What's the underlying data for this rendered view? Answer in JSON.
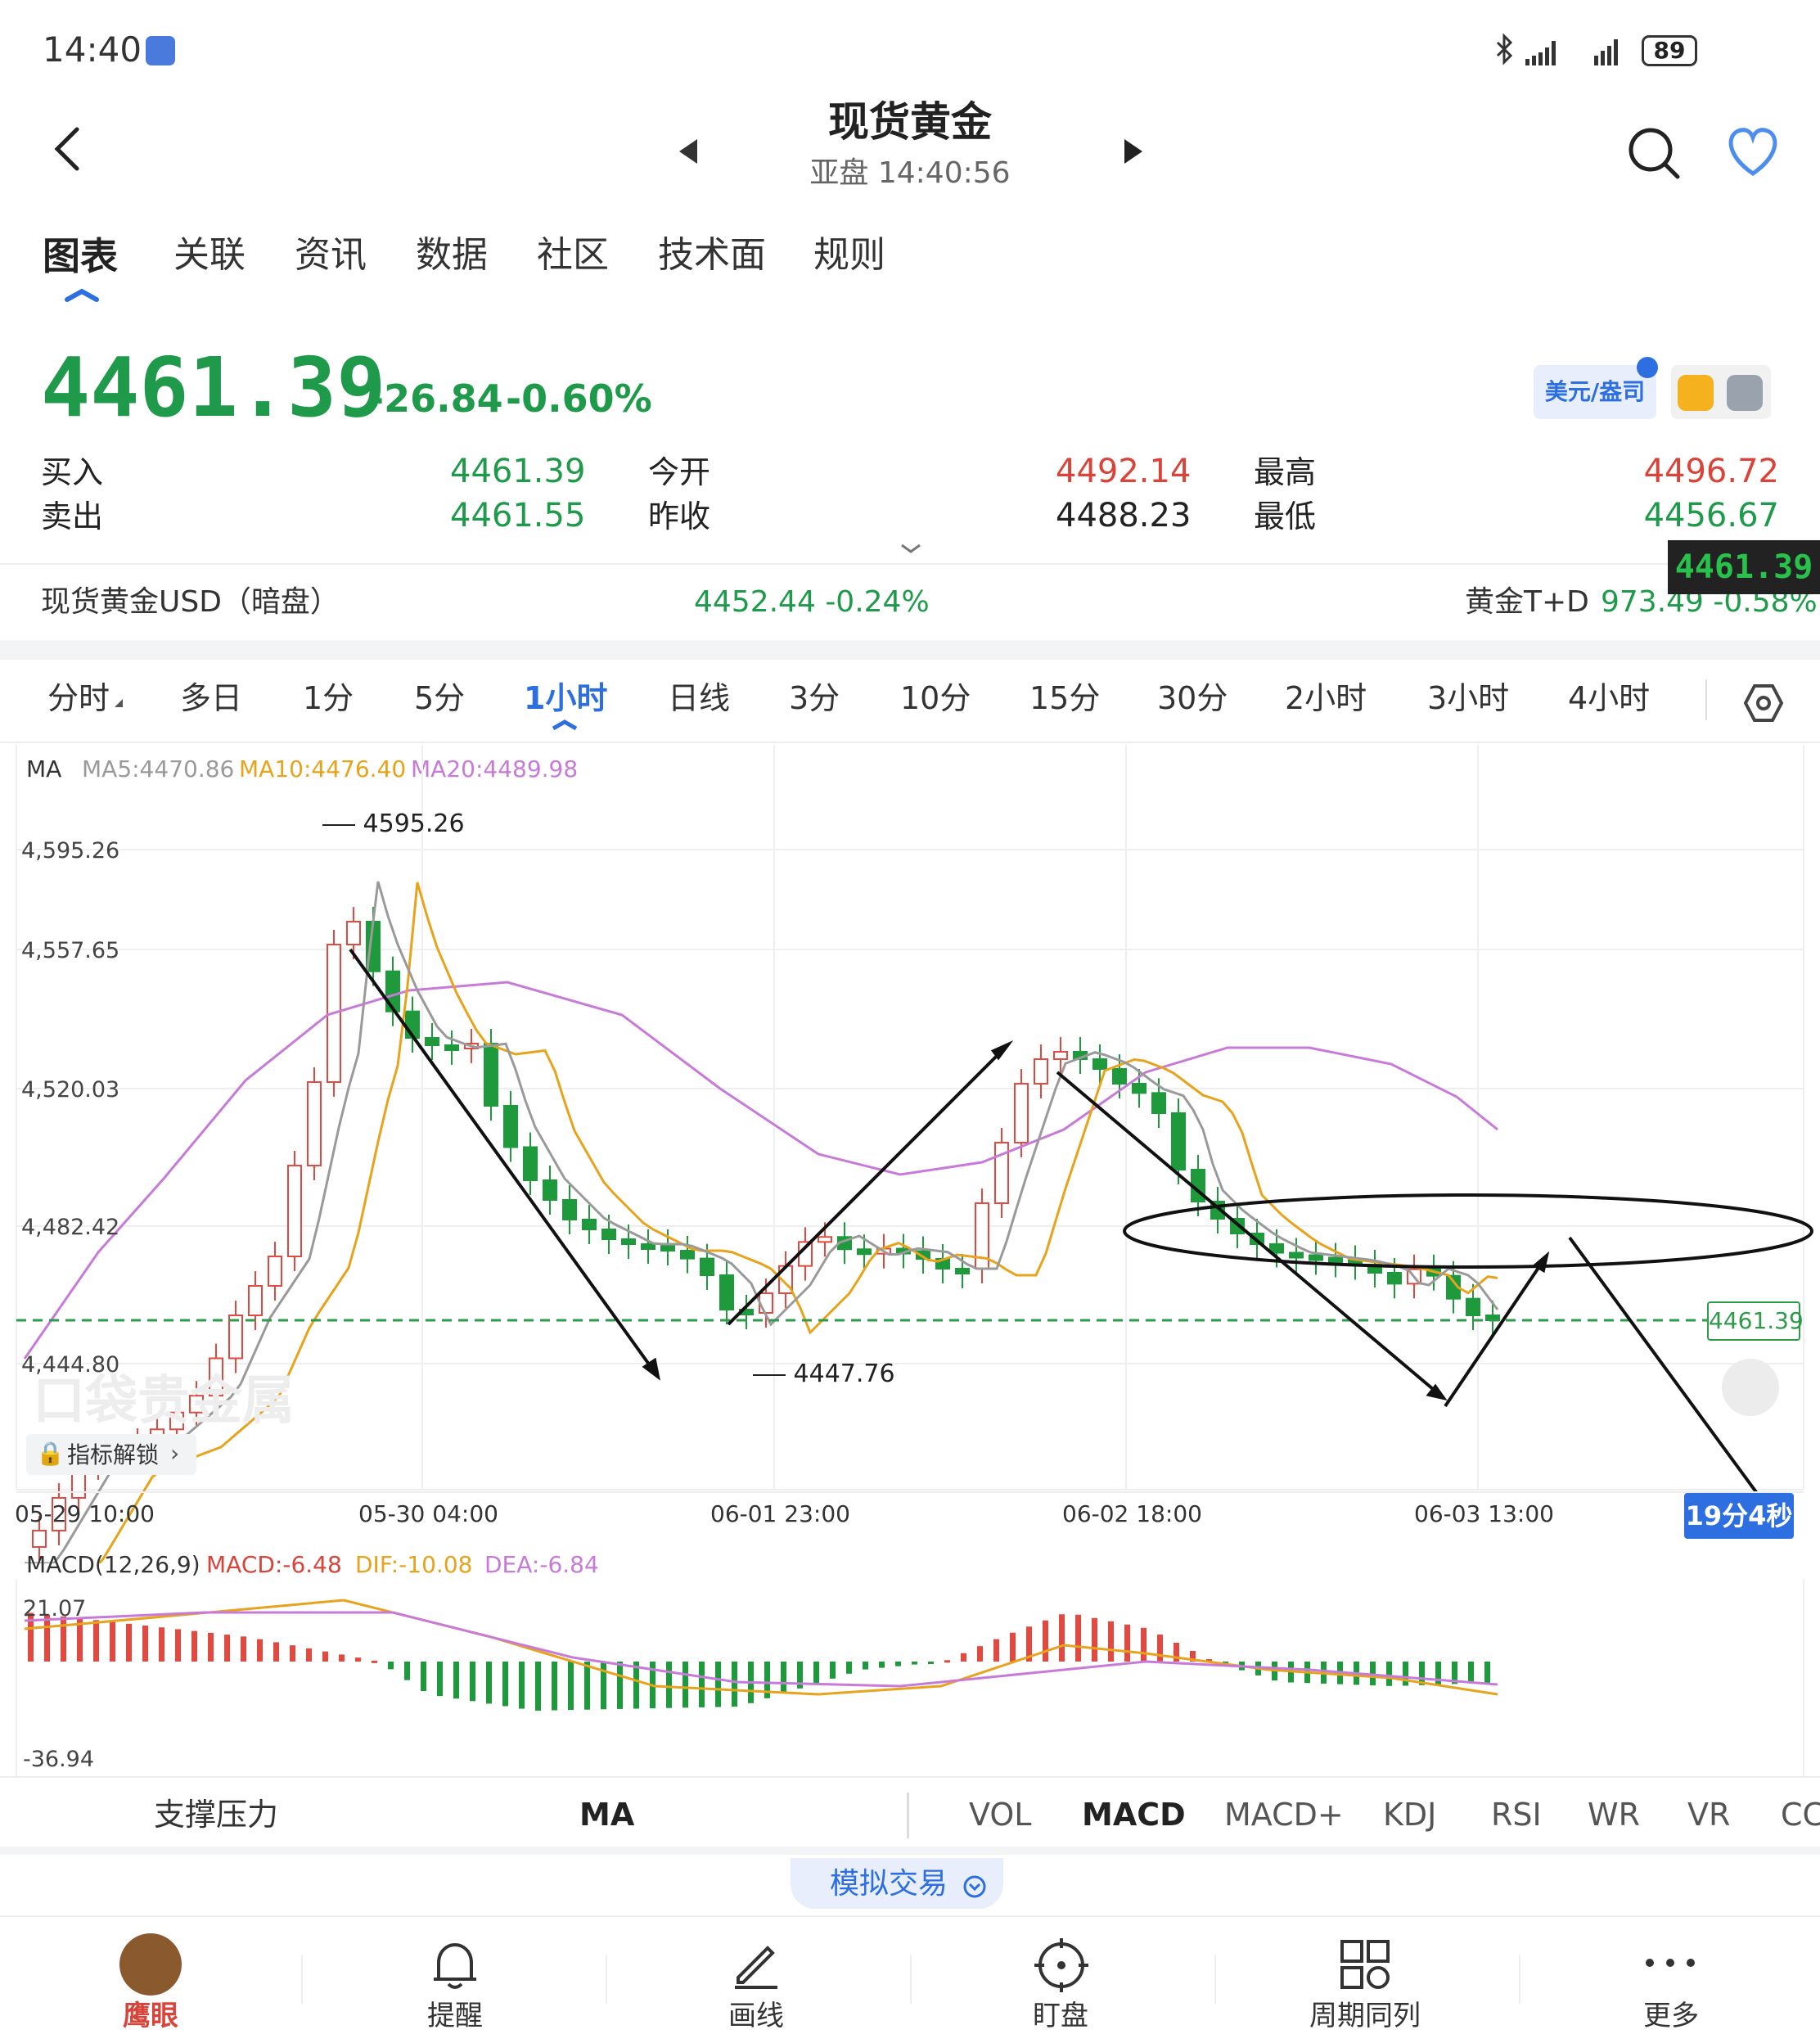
{
  "status": {
    "time": "14:40",
    "battery": "89"
  },
  "header": {
    "title": "现货黄金",
    "subtitle": "亚盘  14:40:56"
  },
  "nav_tabs": [
    "图表",
    "关联",
    "资讯",
    "数据",
    "社区",
    "技术面",
    "规则"
  ],
  "quote": {
    "price": "4461.39",
    "change": "-26.84",
    "change_pct": "-0.60%",
    "currency_label": "美元/盎司",
    "bid_label": "买入",
    "bid": "4461.39",
    "ask_label": "卖出",
    "ask": "4461.55",
    "open_label": "今开",
    "open": "4492.14",
    "prev_close_label": "昨收",
    "prev_close": "4488.23",
    "high_label": "最高",
    "high": "4496.72",
    "low_label": "最低",
    "low": "4456.67",
    "dark_label": "现货黄金USD（暗盘）",
    "dark_value": "4452.44 -0.24%",
    "td_label": "黄金T+D",
    "td_value": "973.49 -0.58%",
    "price_tag": "4461.39"
  },
  "periods": [
    "分时",
    "多日",
    "1分",
    "5分",
    "1小时",
    "日线",
    "3分",
    "10分",
    "15分",
    "30分",
    "2小时",
    "3小时",
    "4小时"
  ],
  "chart": {
    "ma_legend": {
      "ma": "MA",
      "ma5": "MA5:4470.86",
      "ma10": "MA10:4476.40",
      "ma20": "MA20:4489.98"
    },
    "y_ticks": [
      "4,595.26",
      "4,557.65",
      "4,520.03",
      "4,482.42",
      "4,444.80"
    ],
    "x_ticks": [
      "05-29 10:00",
      "05-30 04:00",
      "06-01 23:00",
      "06-02 18:00",
      "06-03 13:00"
    ],
    "high_mark": "4595.26",
    "low_mark": "4447.76",
    "price_line": "4461.39",
    "countdown": "19分4秒",
    "unlock": "指标解锁",
    "watermark": "口袋贵金属",
    "colors": {
      "up": "#e04a40",
      "down": "#1e9a3c",
      "ma5": "#9a9a9a",
      "ma10": "#e8a31c",
      "ma20": "#c77ad8"
    }
  },
  "macd": {
    "title": "MACD(12,26,9)",
    "macd": "MACD:-6.48",
    "dif": "DIF:-10.08",
    "dea": "DEA:-6.84",
    "y_top": "21.07",
    "y_bottom": "-36.94"
  },
  "indicator_tabs": {
    "left": "支撑压力",
    "ma": "MA",
    "items": [
      "VOL",
      "MACD",
      "MACD+",
      "KDJ",
      "RSI",
      "WR",
      "VR",
      "CC"
    ]
  },
  "sim_trade": "模拟交易",
  "bottom_nav": [
    "鹰眼",
    "提醒",
    "画线",
    "盯盘",
    "周期同列",
    "更多"
  ]
}
